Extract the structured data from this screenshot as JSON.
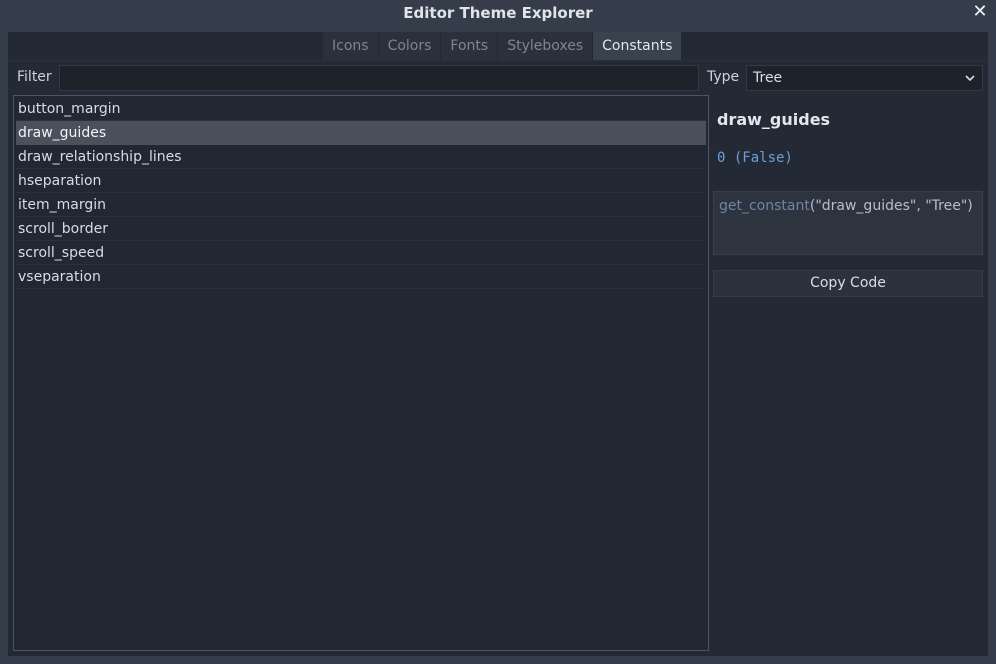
{
  "window": {
    "title": "Editor Theme Explorer",
    "close_glyph": "✕"
  },
  "tabs": [
    {
      "label": "Icons",
      "active": false
    },
    {
      "label": "Colors",
      "active": false
    },
    {
      "label": "Fonts",
      "active": false
    },
    {
      "label": "Styleboxes",
      "active": false
    },
    {
      "label": "Constants",
      "active": true
    }
  ],
  "filter": {
    "label": "Filter",
    "value": "",
    "placeholder": ""
  },
  "type": {
    "label": "Type",
    "value": "Tree",
    "chevron_icon": "chevron-down-icon"
  },
  "constants": [
    "button_margin",
    "draw_guides",
    "draw_relationship_lines",
    "hseparation",
    "item_margin",
    "scroll_border",
    "scroll_speed",
    "vseparation"
  ],
  "selected": "draw_guides",
  "detail": {
    "name": "draw_guides",
    "value": "0 (False)",
    "code_fn": "get_constant",
    "code_args": "(\"draw_guides\", \"Tree\")",
    "copy_label": "Copy Code"
  },
  "colors": {
    "background": "#363d4a",
    "panel": "#242a35",
    "selection": "#4a505c",
    "value_blue": "#6b9edb"
  }
}
